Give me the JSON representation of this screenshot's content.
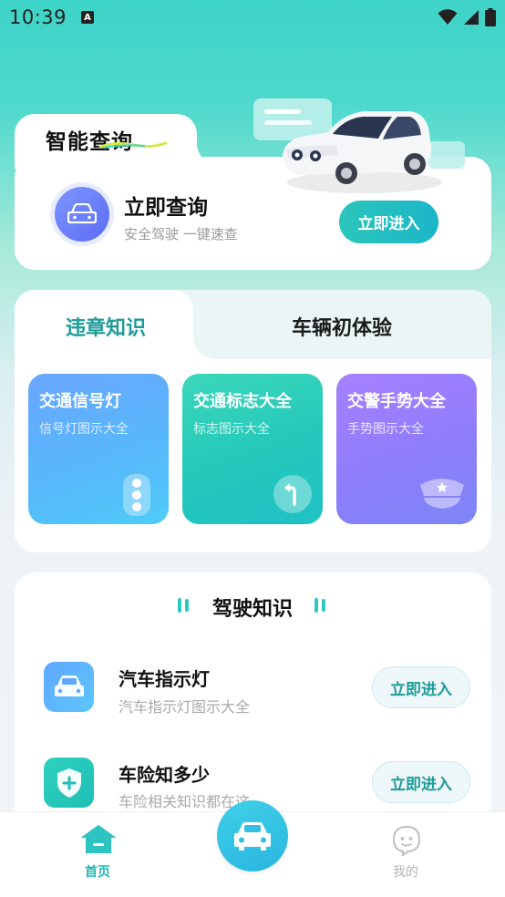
{
  "status_bar": {
    "time": "10:39",
    "a_badge": "A"
  },
  "query_card": {
    "title": "智能查询",
    "main_label": "立即查询",
    "sub_label": "安全驾驶 一键速查",
    "button_label": "立即进入"
  },
  "knowledge": {
    "tabs": [
      {
        "label": "违章知识",
        "active": true
      },
      {
        "label": "车辆初体验",
        "active": false
      }
    ],
    "cards": [
      {
        "title": "交通信号灯",
        "subtitle": "信号灯图示大全",
        "icon": "traffic-light-icon"
      },
      {
        "title": "交通标志大全",
        "subtitle": "标志图示大全",
        "icon": "turn-sign-icon"
      },
      {
        "title": "交警手势大全",
        "subtitle": "手势图示大全",
        "icon": "police-cap-icon"
      }
    ]
  },
  "driving": {
    "title": "驾驶知识",
    "rows": [
      {
        "title": "汽车指示灯",
        "subtitle": "汽车指示灯图示大全",
        "button": "立即进入",
        "icon": "car-icon"
      },
      {
        "title": "车险知多少",
        "subtitle": "车险相关知识都在这",
        "button": "立即进入",
        "icon": "shield-plus-icon"
      }
    ]
  },
  "bottom_nav": {
    "items": [
      {
        "label": "首页",
        "active": true,
        "icon": "home-icon"
      },
      {
        "label": "",
        "icon": "car-icon"
      },
      {
        "label": "我的",
        "active": false,
        "icon": "profile-icon"
      }
    ]
  },
  "colors": {
    "accent": "#23b8b8",
    "button_gradient_start": "#2bc6bb",
    "card_blue": "#58b7fb",
    "card_teal": "#24c8bb",
    "card_purple": "#8e7dfc"
  }
}
